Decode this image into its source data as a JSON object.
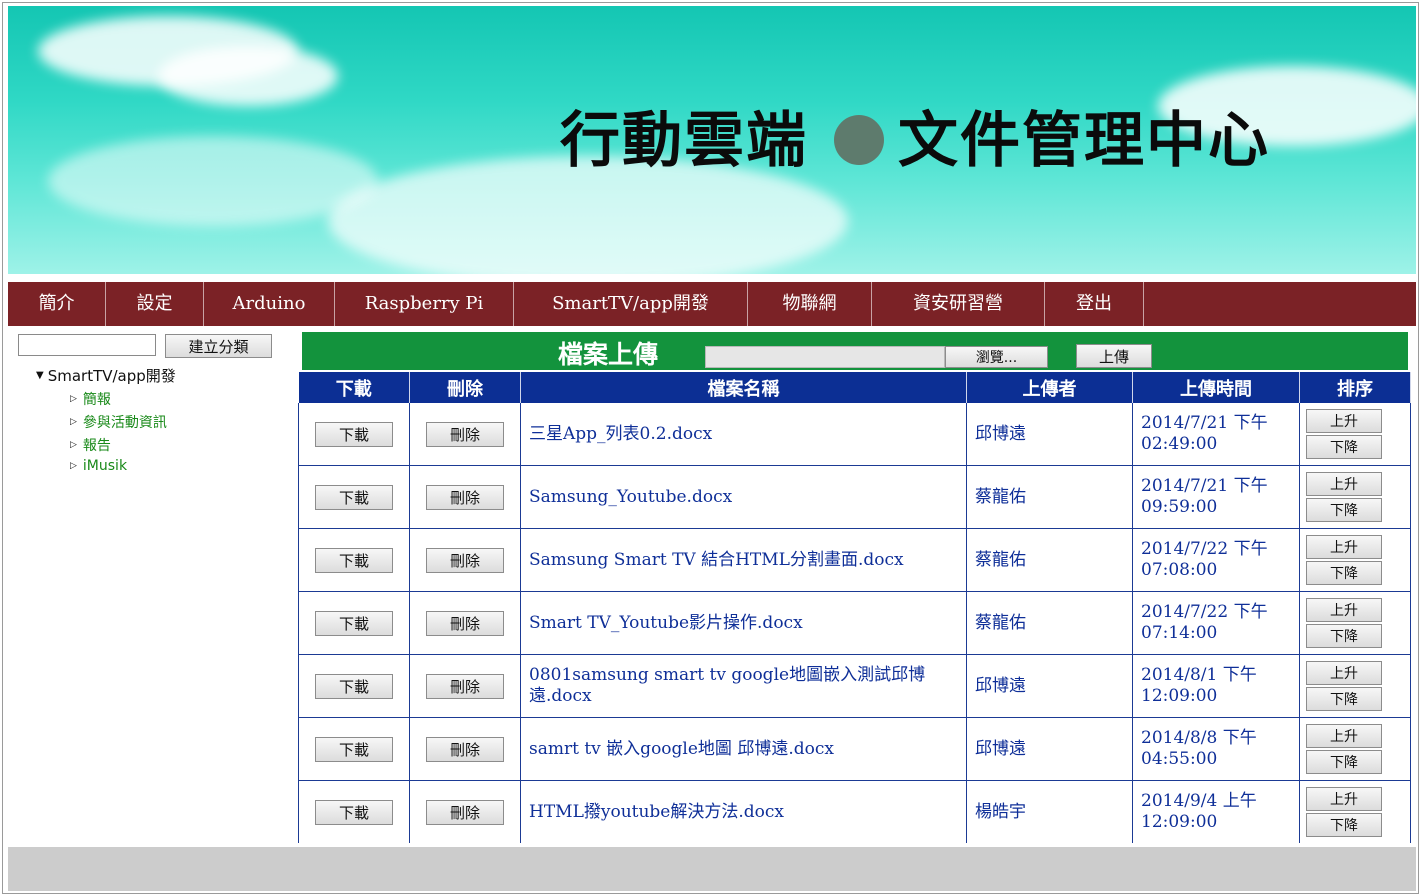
{
  "banner": {
    "title_left": "行動雲端",
    "title_right": "文件管理中心"
  },
  "nav": {
    "items": [
      {
        "label": "簡介"
      },
      {
        "label": "設定"
      },
      {
        "label": "Arduino"
      },
      {
        "label": "Raspberry Pi"
      },
      {
        "label": "SmartTV/app開發"
      },
      {
        "label": "物聯網"
      },
      {
        "label": "資安研習營"
      },
      {
        "label": "登出"
      }
    ]
  },
  "sidebar": {
    "category_input_value": "",
    "create_category_label": "建立分類",
    "tree_root": "SmartTV/app開發",
    "tree_children": [
      {
        "label": "簡報"
      },
      {
        "label": "參與活動資訊"
      },
      {
        "label": "報告"
      },
      {
        "label": "iMusik"
      }
    ]
  },
  "upload": {
    "title": "檔案上傳",
    "file_value": "",
    "browse_label": "瀏覽...",
    "upload_label": "上傳"
  },
  "table": {
    "headers": [
      "下載",
      "刪除",
      "檔案名稱",
      "上傳者",
      "上傳時間",
      "排序"
    ],
    "download_label": "下載",
    "delete_label": "刪除",
    "sort_up_label": "上升",
    "sort_down_label": "下降",
    "rows": [
      {
        "name": "三星App_列表0.2.docx",
        "uploader": "邱博遠",
        "time": "2014/7/21 下午 02:49:00"
      },
      {
        "name": "Samsung_Youtube.docx",
        "uploader": "蔡龍佑",
        "time": "2014/7/21 下午 09:59:00"
      },
      {
        "name": "Samsung Smart TV 結合HTML分割畫面.docx",
        "uploader": "蔡龍佑",
        "time": "2014/7/22 下午 07:08:00"
      },
      {
        "name": "Smart TV_Youtube影片操作.docx",
        "uploader": "蔡龍佑",
        "time": "2014/7/22 下午 07:14:00"
      },
      {
        "name": "0801samsung smart tv google地圖嵌入測試邱博遠.docx",
        "uploader": "邱博遠",
        "time": "2014/8/1 下午 12:09:00"
      },
      {
        "name": "samrt tv 嵌入google地圖 邱博遠.docx",
        "uploader": "邱博遠",
        "time": "2014/8/8 下午 04:55:00"
      },
      {
        "name": "HTML撥youtube解決方法.docx",
        "uploader": "楊皓宇",
        "time": "2014/9/4 上午 12:09:00"
      }
    ]
  },
  "colors": {
    "nav_bg": "#7b2226",
    "upload_bar_bg": "#13933d",
    "table_header_bg": "#0c2f94",
    "link_text": "#0f2f98",
    "tree_child_text": "#1a8a1a"
  }
}
